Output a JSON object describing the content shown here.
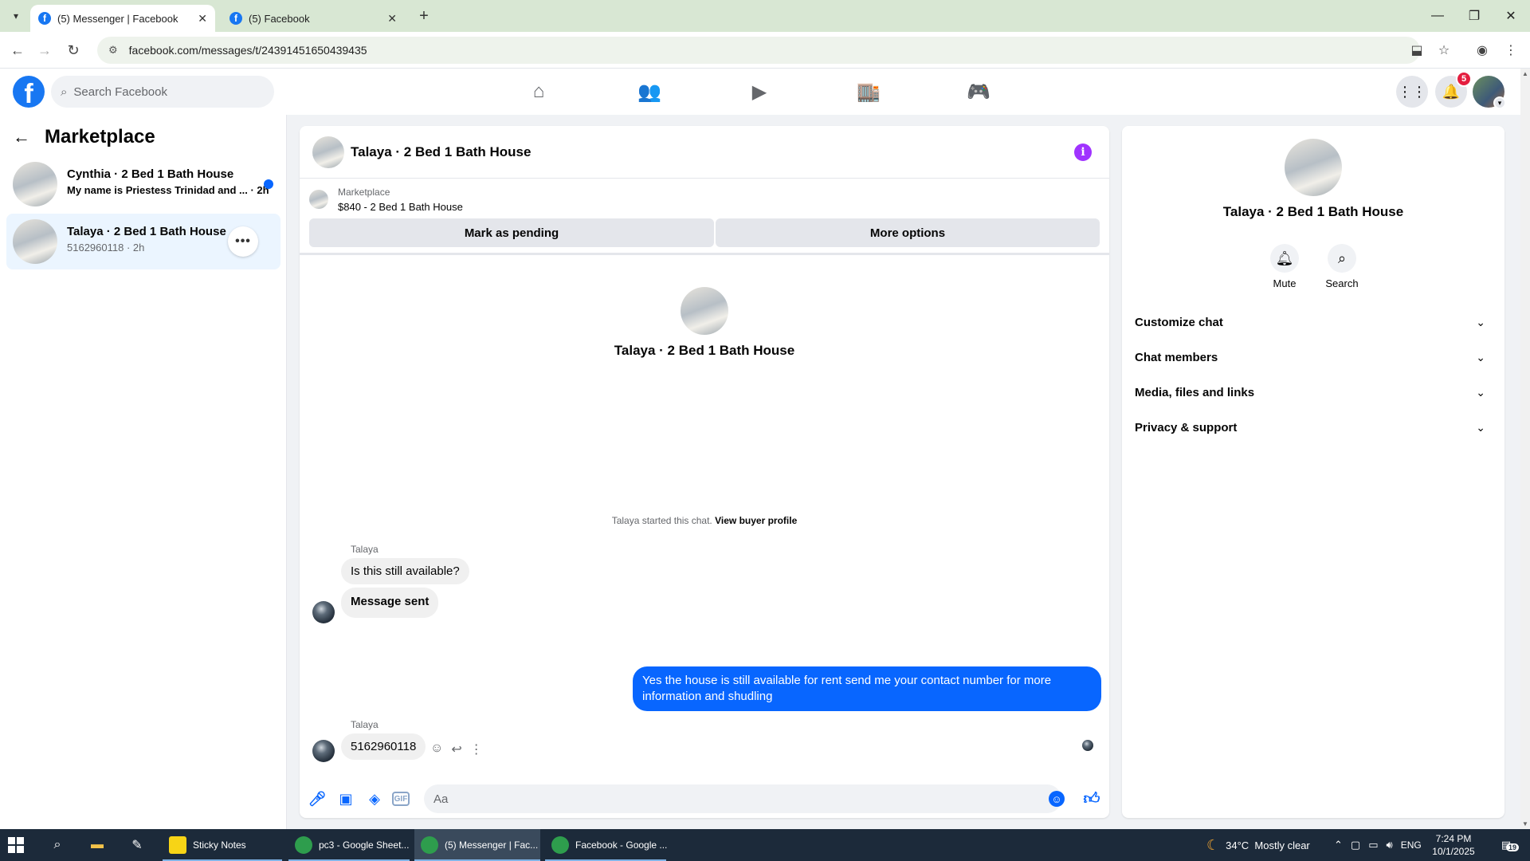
{
  "browser": {
    "tabs": [
      {
        "title": "(5) Messenger | Facebook",
        "active": true
      },
      {
        "title": "(5) Facebook",
        "active": false
      }
    ],
    "url": "facebook.com/messages/t/24391451650439435"
  },
  "fbnav": {
    "search_placeholder": "Search Facebook",
    "notification_count": "5",
    "logo": "f"
  },
  "sidebar": {
    "title": "Marketplace",
    "conversations": [
      {
        "name": "Cynthia · 2 Bed 1 Bath House",
        "preview": "My name is Priestess Trinidad and ... · 2h",
        "unread": true
      },
      {
        "name": "Talaya · 2 Bed 1 Bath House",
        "preview": "5162960118 · 2h",
        "active": true
      }
    ]
  },
  "chat": {
    "title": "Talaya · 2 Bed 1 Bath House",
    "listing_source": "Marketplace",
    "listing_title": "$840 - 2 Bed 1 Bath House",
    "btn_pending": "Mark as pending",
    "btn_more": "More options",
    "intro_name": "Talaya · 2 Bed 1 Bath House",
    "started_text": "Talaya started this chat.",
    "view_profile": "View buyer profile",
    "messages": [
      {
        "sender": "Talaya",
        "text": "Is this still available?"
      },
      {
        "text": "Message sent"
      },
      {
        "outgoing": true,
        "text": "Yes the house is still available for rent send me your contact number for more information and shudling"
      },
      {
        "sender": "Talaya",
        "text": "5162960118"
      }
    ],
    "composer_placeholder": "Aa",
    "gif_label": "GIF"
  },
  "info_panel": {
    "name": "Talaya · 2 Bed 1 Bath House",
    "actions": [
      {
        "label": "Mute"
      },
      {
        "label": "Search"
      }
    ],
    "sections": [
      "Customize chat",
      "Chat members",
      "Media, files and links",
      "Privacy & support"
    ]
  },
  "taskbar": {
    "apps": [
      {
        "label": "Sticky Notes"
      },
      {
        "label": "pc3 - Google Sheet..."
      },
      {
        "label": "(5) Messenger | Fac..."
      },
      {
        "label": "Facebook - Google ..."
      }
    ],
    "weather": "34°C  Mostly clear",
    "lang": "ENG",
    "time": "7:24 PM",
    "date": "10/1/2025",
    "notif_count": "19"
  },
  "colors": {
    "fb_blue": "#1877f2",
    "messenger_blue": "#0866ff",
    "info_purple": "#a033ff",
    "badge_red": "#e41e3f"
  }
}
